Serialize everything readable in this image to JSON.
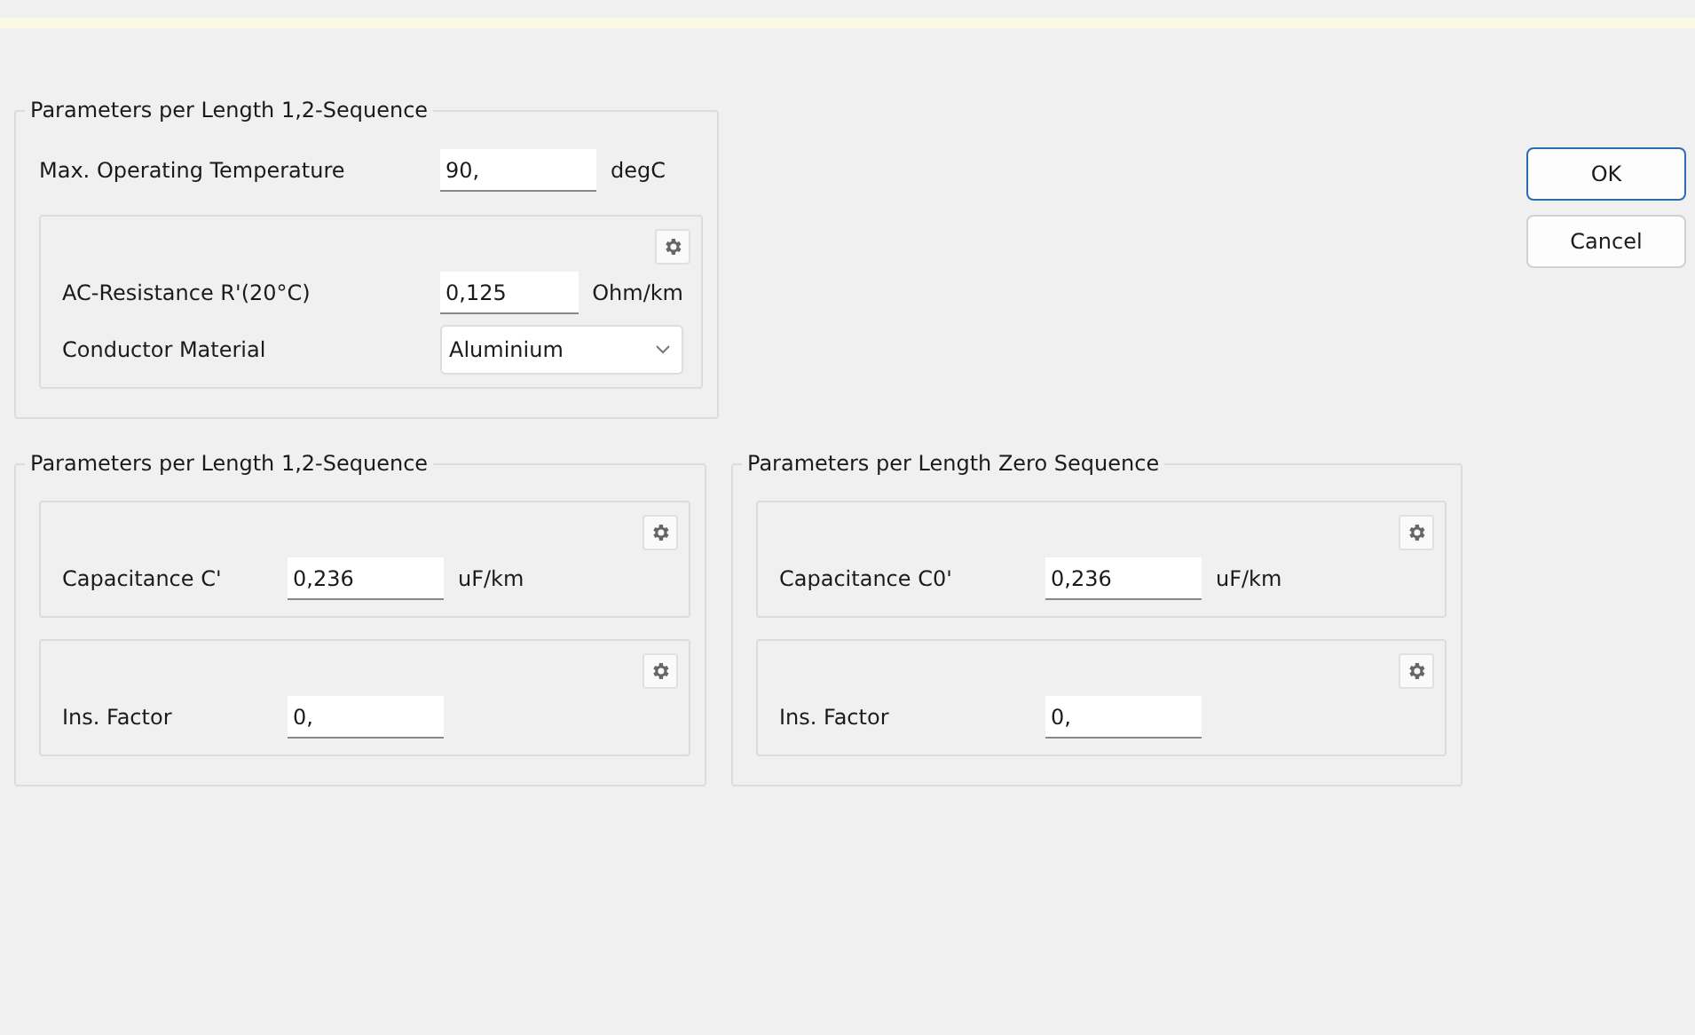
{
  "groups": [
    {
      "title": "Parameters per Length 1,2-Sequence",
      "items": [
        {
          "kind": "input",
          "label": "Max. Operating Temperature",
          "value": "90,",
          "unit": "degC"
        },
        {
          "kind": "panel",
          "rows": [
            {
              "kind": "input",
              "label": "AC-Resistance R'(20°C)",
              "value": "0,125",
              "unit": "Ohm/km"
            },
            {
              "kind": "dropdown",
              "label": "Conductor Material",
              "value": "Aluminium"
            }
          ]
        }
      ]
    },
    {
      "title": "Parameters per Length 1,2-Sequence",
      "items": [
        {
          "kind": "panel",
          "rows": [
            {
              "kind": "input",
              "label": "Capacitance C'",
              "value": "0,236",
              "unit": "uF/km"
            }
          ]
        },
        {
          "kind": "panel",
          "rows": [
            {
              "kind": "input",
              "label": "Ins. Factor",
              "value": "0,"
            }
          ]
        }
      ]
    },
    {
      "title": "Parameters per Length Zero Sequence",
      "items": [
        {
          "kind": "panel",
          "rows": [
            {
              "kind": "input",
              "label": "Capacitance C0'",
              "value": "0,236",
              "unit": "uF/km"
            }
          ]
        },
        {
          "kind": "panel",
          "rows": [
            {
              "kind": "input",
              "label": "Ins. Factor",
              "value": "0,"
            }
          ]
        }
      ]
    }
  ],
  "buttons": [
    {
      "label": "OK",
      "selected": true
    },
    {
      "label": "Cancel",
      "selected": false
    }
  ]
}
